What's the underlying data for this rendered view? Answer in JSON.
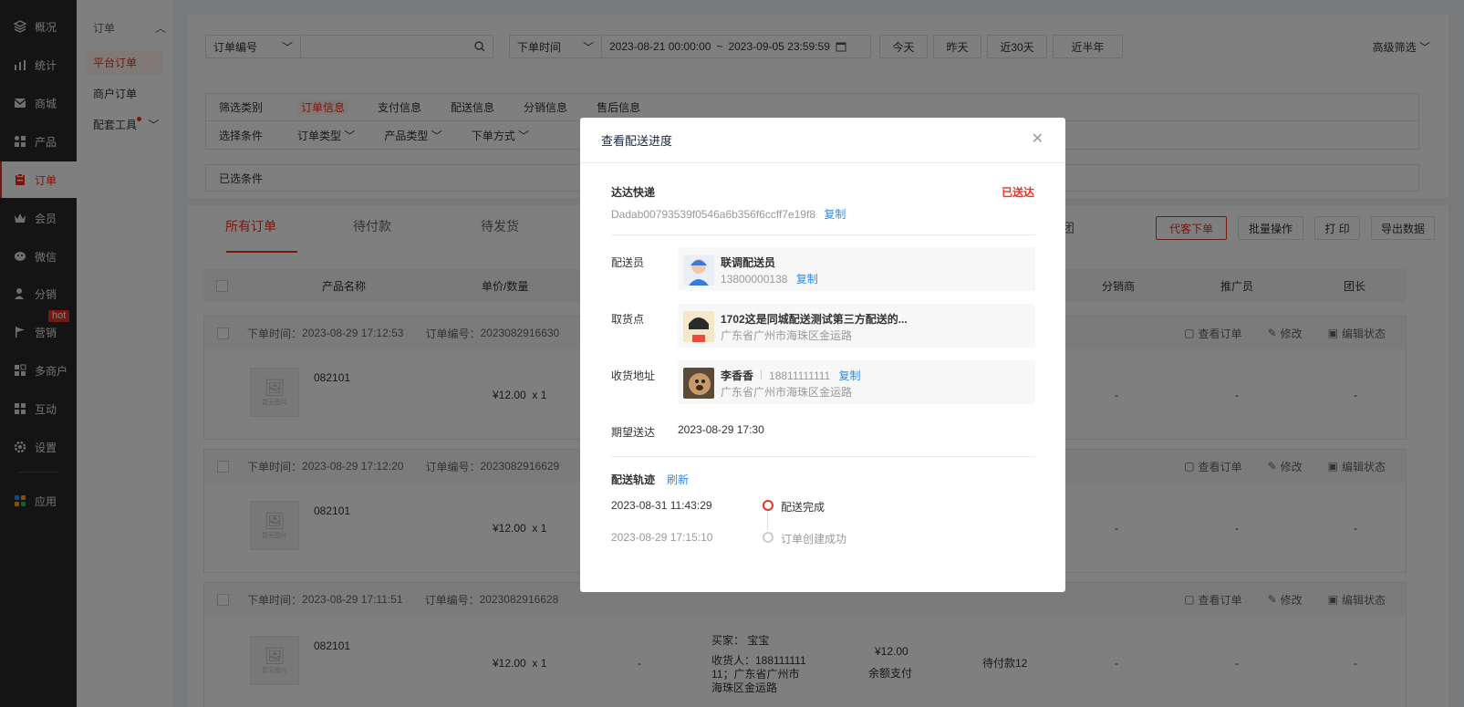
{
  "nav": {
    "items": [
      {
        "label": "概况",
        "icon": "layers-icon"
      },
      {
        "label": "统计",
        "icon": "chart-icon"
      },
      {
        "label": "商城",
        "icon": "mail-icon"
      },
      {
        "label": "产品",
        "icon": "grid-icon"
      },
      {
        "label": "订单",
        "icon": "clipboard-icon"
      },
      {
        "label": "会员",
        "icon": "crown-icon"
      },
      {
        "label": "微信",
        "icon": "chat-icon"
      },
      {
        "label": "分销",
        "icon": "person-icon"
      },
      {
        "label": "营销",
        "icon": "flag-icon"
      },
      {
        "label": "多商户",
        "icon": "shop-icon"
      },
      {
        "label": "互动",
        "icon": "blocks-icon"
      },
      {
        "label": "设置",
        "icon": "gear-icon"
      },
      {
        "label": "应用",
        "icon": "apps-icon"
      }
    ],
    "hot_badge": "hot"
  },
  "subnav": {
    "title": "订单",
    "items": [
      "平台订单",
      "商户订单",
      "配套工具"
    ]
  },
  "search": {
    "field_select": "订单编号",
    "time_select": "下单时间",
    "date_start": "2023-08-21 00:00:00",
    "date_sep": "~",
    "date_end": "2023-09-05 23:59:59",
    "quick": [
      "今天",
      "昨天",
      "近30天",
      "近半年"
    ],
    "advanced": "高级筛选"
  },
  "filters": {
    "row1_label": "筛选类别",
    "row1_opts": [
      "订单信息",
      "支付信息",
      "配送信息",
      "分销信息",
      "售后信息"
    ],
    "row2_label": "选择条件",
    "row2_opts": [
      "订单类型",
      "产品类型",
      "下单方式"
    ],
    "selected_label": "已选条件"
  },
  "tabs": [
    "所有订单",
    "待付款",
    "待发货"
  ],
  "tab_extra": "团",
  "actions": [
    "代客下单",
    "批量操作",
    "打 印",
    "导出数据"
  ],
  "table": {
    "headers": [
      "产品名称",
      "单价/数量",
      "分销商",
      "推广员",
      "团长"
    ]
  },
  "orders": [
    {
      "time_label": "下单时间：",
      "time": "2023-08-29 17:12:53",
      "no_label": "订单编号：",
      "no": "2023082916630",
      "product": "082101",
      "price": "¥12.00",
      "qty": "x 1",
      "dist": "-",
      "promo": "-",
      "leader": "-"
    },
    {
      "time_label": "下单时间：",
      "time": "2023-08-29 17:12:20",
      "no_label": "订单编号：",
      "no": "2023082916629",
      "product": "082101",
      "price": "¥12.00",
      "qty": "x 1",
      "dist": "-",
      "promo": "-",
      "leader": "-"
    },
    {
      "time_label": "下单时间：",
      "time": "2023-08-29 17:11:51",
      "no_label": "订单编号：",
      "no": "2023082916628",
      "product": "082101",
      "price": "¥12.00",
      "qty": "x 1",
      "dash": "-",
      "buyer_label": "买家：",
      "buyer": "宝宝",
      "receiver": "收货人：188111111 11；广东省广州市海珠区金运路",
      "amount": "¥12.00",
      "pay": "余额支付",
      "status": "待付款12",
      "dist": "-",
      "promo": "-",
      "leader": "-"
    }
  ],
  "order_ops": [
    "查看订单",
    "修改",
    "编辑状态"
  ],
  "no_image": "暂无图片",
  "modal": {
    "title": "查看配送进度",
    "courier": "达达快递",
    "status": "已送达",
    "tracking_no": "Dadab00793539f0546a6b356f6ccff7e19f8",
    "copy": "复制",
    "rider_label": "配送员",
    "rider_name": "联调配送员",
    "rider_phone": "13800000138",
    "pickup_label": "取货点",
    "pickup_name": "1702这是同城配送测试第三方配送的...",
    "pickup_addr": "广东省广州市海珠区金运路",
    "receiver_label": "收货地址",
    "receiver_name": "李香香",
    "receiver_phone": "18811111111",
    "receiver_addr": "广东省广州市海珠区金运路",
    "expect_label": "期望送达",
    "expect_time": "2023-08-29 17:30",
    "track_label": "配送轨迹",
    "refresh": "刷新",
    "track": [
      {
        "time": "2023-08-31 11:43:29",
        "text": "配送完成"
      },
      {
        "time": "2023-08-29 17:15:10",
        "text": "订单创建成功"
      }
    ]
  },
  "colors": {
    "accent": "#e93323",
    "link": "#2d8cf0",
    "nav_bg": "#282828"
  }
}
